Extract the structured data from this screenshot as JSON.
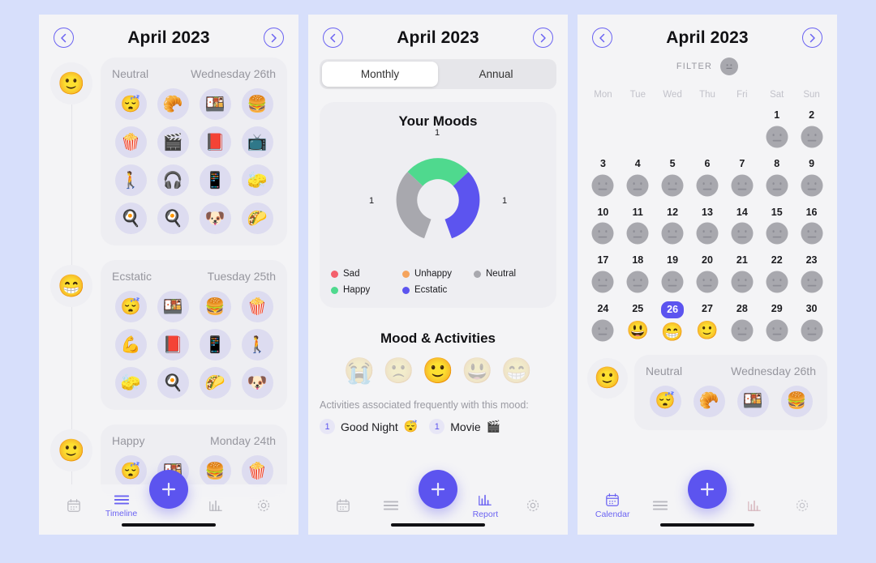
{
  "page": {
    "background_color": "#d7dffb",
    "screen_background": "#f4f4f6",
    "accent_color": "#5c54ef"
  },
  "timeline_screen": {
    "header": {
      "title": "April 2023",
      "prev_icon": "chevron-left-icon",
      "next_icon": "chevron-right-icon"
    },
    "entries": [
      {
        "face": "🙂",
        "mood": "Neutral",
        "date": "Wednesday 26th",
        "activities": [
          "😴",
          "🥐",
          "🍱",
          "🍔",
          "🍿",
          "🎬",
          "📕",
          "📺",
          "🚶",
          "🎧",
          "📱",
          "🧽",
          "🍳",
          "🍳",
          "🐶",
          "🌮"
        ]
      },
      {
        "face": "😁",
        "mood": "Ecstatic",
        "date": "Tuesday 25th",
        "activities": [
          "😴",
          "🍱",
          "🍔",
          "🍿",
          "💪",
          "📕",
          "📱",
          "🚶",
          "🧽",
          "🍳",
          "🌮",
          "🐶"
        ]
      },
      {
        "face": "🙂",
        "mood": "Happy",
        "date": "Monday 24th",
        "activities": [
          "😴",
          "🍱",
          "🍔",
          "🍿"
        ]
      }
    ],
    "navbar": {
      "items": [
        {
          "icon": "calendar-icon",
          "label": "",
          "active": false
        },
        {
          "icon": "list-icon",
          "label": "Timeline",
          "active": true
        },
        {
          "icon": "chart-icon",
          "label": "",
          "active": false
        },
        {
          "icon": "gear-icon",
          "label": "",
          "active": false
        }
      ],
      "fab_label": "+"
    }
  },
  "report_screen": {
    "header": {
      "title": "April 2023",
      "prev_icon": "chevron-left-icon",
      "next_icon": "chevron-right-icon"
    },
    "segments": [
      {
        "label": "Monthly",
        "selected": true
      },
      {
        "label": "Annual",
        "selected": false
      }
    ],
    "moods_card_title": "Your Moods",
    "legend": [
      {
        "label": "Sad",
        "color": "#f4606c"
      },
      {
        "label": "Unhappy",
        "color": "#f5a35c"
      },
      {
        "label": "Neutral",
        "color": "#a8a8ae"
      },
      {
        "label": "Happy",
        "color": "#4fd98e"
      },
      {
        "label": "Ecstatic",
        "color": "#5c54ef"
      }
    ],
    "mood_activities_title": "Mood & Activities",
    "faces": [
      {
        "emoji": "😭",
        "selected": false
      },
      {
        "emoji": "🙁",
        "selected": false
      },
      {
        "emoji": "🙂",
        "selected": true
      },
      {
        "emoji": "😃",
        "selected": false
      },
      {
        "emoji": "😁",
        "selected": false
      }
    ],
    "activities_subtitle": "Activities associated frequently with this mood:",
    "activities": [
      {
        "count": "1",
        "label": "Good Night",
        "emoji": "😴"
      },
      {
        "count": "1",
        "label": "Movie",
        "emoji": "🎬"
      }
    ],
    "navbar": {
      "items": [
        {
          "icon": "calendar-icon",
          "label": "",
          "active": false
        },
        {
          "icon": "list-icon",
          "label": "",
          "active": false
        },
        {
          "icon": "chart-icon",
          "label": "Report",
          "active": true
        },
        {
          "icon": "gear-icon",
          "label": "",
          "active": false
        }
      ],
      "fab_label": "+"
    },
    "chart_data": {
      "type": "pie",
      "title": "Your Moods",
      "subtype": "donut",
      "categories": [
        "Sad",
        "Unhappy",
        "Neutral",
        "Happy",
        "Ecstatic"
      ],
      "values": [
        0,
        0,
        1,
        1,
        1
      ],
      "colors": [
        "#f4606c",
        "#f5a35c",
        "#a8a8ae",
        "#4fd98e",
        "#5c54ef"
      ],
      "data_labels": [
        "1",
        "1",
        "1"
      ],
      "visible_segments": [
        {
          "name": "Happy",
          "value": 1,
          "color": "#4fd98e",
          "label": "1",
          "label_position": "top"
        },
        {
          "name": "Ecstatic",
          "value": 1,
          "color": "#5c54ef",
          "label": "1",
          "label_position": "right"
        },
        {
          "name": "Neutral",
          "value": 1,
          "color": "#a8a8ae",
          "label": "1",
          "label_position": "left"
        }
      ],
      "total": 3,
      "legend_position": "bottom",
      "grid": false,
      "xlabel": "",
      "ylabel": ""
    }
  },
  "calendar_screen": {
    "header": {
      "title": "April 2023",
      "prev_icon": "chevron-left-icon",
      "next_icon": "chevron-right-icon"
    },
    "filter": {
      "label": "FILTER",
      "face": "neutral-face-icon"
    },
    "weekdays": [
      "Mon",
      "Tue",
      "Wed",
      "Thu",
      "Fri",
      "Sat",
      "Sun"
    ],
    "leading_blanks": 5,
    "days": [
      {
        "n": "1",
        "mood": "none"
      },
      {
        "n": "2",
        "mood": "none"
      },
      {
        "n": "3",
        "mood": "none"
      },
      {
        "n": "4",
        "mood": "none"
      },
      {
        "n": "5",
        "mood": "none"
      },
      {
        "n": "6",
        "mood": "none"
      },
      {
        "n": "7",
        "mood": "none"
      },
      {
        "n": "8",
        "mood": "none"
      },
      {
        "n": "9",
        "mood": "none"
      },
      {
        "n": "10",
        "mood": "none"
      },
      {
        "n": "11",
        "mood": "none"
      },
      {
        "n": "12",
        "mood": "none"
      },
      {
        "n": "13",
        "mood": "none"
      },
      {
        "n": "14",
        "mood": "none"
      },
      {
        "n": "15",
        "mood": "none"
      },
      {
        "n": "16",
        "mood": "none"
      },
      {
        "n": "17",
        "mood": "none"
      },
      {
        "n": "18",
        "mood": "none"
      },
      {
        "n": "19",
        "mood": "none"
      },
      {
        "n": "20",
        "mood": "none"
      },
      {
        "n": "21",
        "mood": "none"
      },
      {
        "n": "22",
        "mood": "none"
      },
      {
        "n": "23",
        "mood": "none"
      },
      {
        "n": "24",
        "mood": "none"
      },
      {
        "n": "25",
        "mood": "happy",
        "emoji": "😃"
      },
      {
        "n": "26",
        "mood": "ecstatic",
        "emoji": "😁",
        "today": true
      },
      {
        "n": "27",
        "mood": "neutral",
        "emoji": "🙂"
      },
      {
        "n": "28",
        "mood": "none"
      },
      {
        "n": "29",
        "mood": "none"
      },
      {
        "n": "30",
        "mood": "none"
      }
    ],
    "detail": {
      "face": "🙂",
      "mood": "Neutral",
      "date": "Wednesday 26th",
      "activities": [
        "😴",
        "🥐",
        "🍱",
        "🍔"
      ]
    },
    "navbar": {
      "items": [
        {
          "icon": "calendar-icon",
          "label": "Calendar",
          "active": true
        },
        {
          "icon": "list-icon",
          "label": "",
          "active": false
        },
        {
          "icon": "chart-icon",
          "label": "",
          "active": false
        },
        {
          "icon": "gear-icon",
          "label": "",
          "active": false
        }
      ],
      "fab_label": "+"
    }
  }
}
